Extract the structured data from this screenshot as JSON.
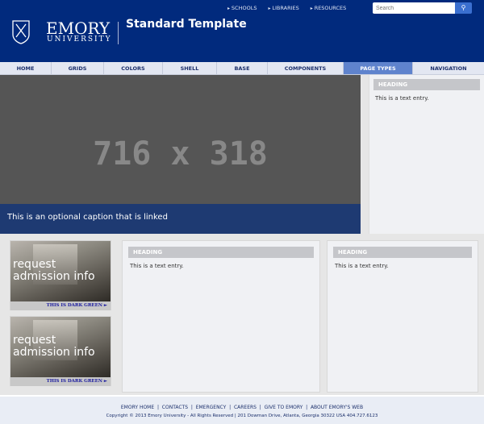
{
  "header": {
    "utility_links": [
      "SCHOOLS",
      "LIBRARIES",
      "RESOURCES"
    ],
    "search_placeholder": "Search",
    "logo_top": "EMORY",
    "logo_bottom": "UNIVERSITY",
    "site_title": "Standard Template"
  },
  "nav": {
    "items": [
      "HOME",
      "GRIDS",
      "COLORS",
      "SHELL",
      "BASE",
      "COMPONENTS",
      "PAGE TYPES",
      "NAVIGATION"
    ],
    "active": "PAGE TYPES"
  },
  "hero": {
    "placeholder": "716 x 318",
    "caption": "This is an optional caption that is linked"
  },
  "sidebar": {
    "heading": "HEADING",
    "text": "This is a text entry."
  },
  "promos": [
    {
      "text": "request admission info",
      "link": "THIS IS DARK GREEN ►"
    },
    {
      "text": "request admission info",
      "link": "THIS IS DARK GREEN ►"
    }
  ],
  "boxes": [
    {
      "heading": "HEADING",
      "text": "This is a text entry."
    },
    {
      "heading": "HEADING",
      "text": "This is a text entry."
    }
  ],
  "footer": {
    "links": "EMORY HOME  |  CONTACTS  |  EMERGENCY  |  CAREERS  |  GIVE TO EMORY  |  ABOUT EMORY'S WEB",
    "copyright": "Copyright © 2013 Emory University - All Rights Reserved | 201 Dowman Drive, Atlanta, Georgia 30322 USA 404.727.6123"
  },
  "colors": {
    "brand": "#012a7d",
    "active_nav": "#5f83cd",
    "caption_bg": "#1e3a72"
  }
}
